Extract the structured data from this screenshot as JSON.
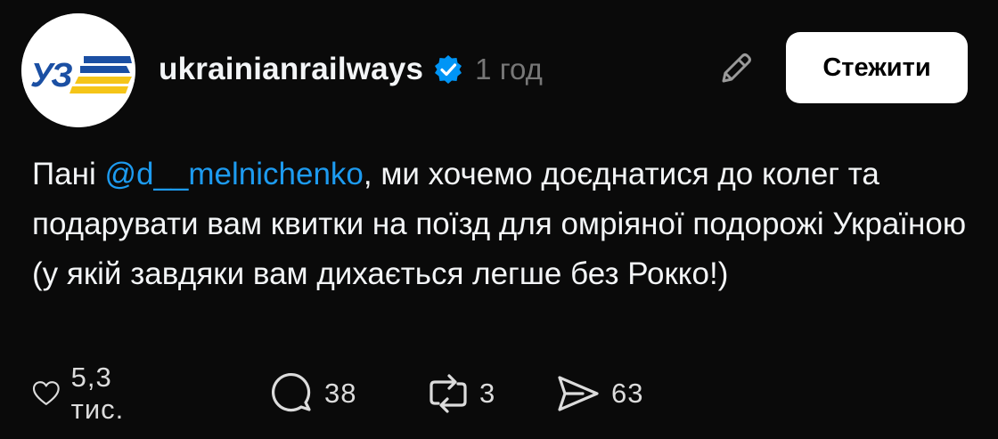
{
  "post": {
    "avatar_logo_text": "УЗ",
    "username": "ukrainianrailways",
    "verified": true,
    "time": "1 год",
    "follow_label": "Стежити",
    "caption": {
      "prefix": "Пані ",
      "mention": "@d__melnichenko",
      "suffix": ", ми хочемо доєднатися до колег та подарувати вам квитки на поїзд для омріяної подорожі Україною (у якій завдяки вам дихається легше без Рокко!)"
    }
  },
  "actions": {
    "likes": "5,3 тис.",
    "comments": "38",
    "reposts": "3",
    "shares": "63"
  },
  "colors": {
    "background": "#0a0a0a",
    "text": "#f3f5f7",
    "mention": "#1d9bf0",
    "timestamp": "#777777",
    "verified_badge": "#0095f6",
    "logo_blue": "#1b4fa3",
    "logo_yellow": "#f5c518"
  },
  "icons": [
    "verified-badge-icon",
    "pencil-icon",
    "heart-icon",
    "comment-bubble-icon",
    "repost-icon",
    "share-send-icon"
  ]
}
